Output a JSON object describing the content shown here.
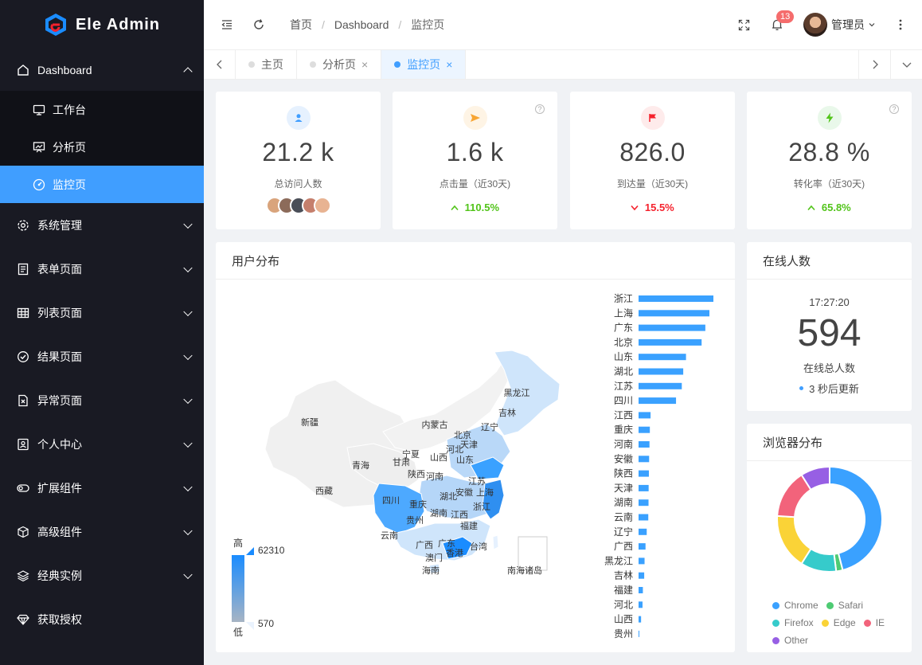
{
  "app": {
    "title": "Ele Admin"
  },
  "sidebar": {
    "dashboard": {
      "label": "Dashboard",
      "children": [
        "工作台",
        "分析页",
        "监控页"
      ]
    },
    "items": [
      "系统管理",
      "表单页面",
      "列表页面",
      "结果页面",
      "异常页面",
      "个人中心",
      "扩展组件",
      "高级组件",
      "经典实例",
      "获取授权"
    ]
  },
  "header": {
    "breadcrumb": [
      "首页",
      "Dashboard",
      "监控页"
    ],
    "notify_count": "13",
    "user_name": "管理员"
  },
  "tabs": [
    {
      "label": "主页",
      "closable": false
    },
    {
      "label": "分析页",
      "closable": true
    },
    {
      "label": "监控页",
      "closable": true,
      "active": true
    }
  ],
  "stats": [
    {
      "value": "21.2 k",
      "label": "总访问人数"
    },
    {
      "value": "1.6 k",
      "label": "点击量（近30天)",
      "trend": "110.5%",
      "dir": "up"
    },
    {
      "value": "826.0",
      "label": "到达量（近30天)",
      "trend": "15.5%",
      "dir": "down"
    },
    {
      "value": "28.8 %",
      "label": "转化率（近30天)",
      "trend": "65.8%",
      "dir": "up"
    }
  ],
  "user_dist": {
    "title": "用户分布",
    "scale_high": "高",
    "scale_low": "低",
    "scale_max": "62310",
    "scale_min": "570",
    "map_labels": [
      "黑龙江",
      "吉林",
      "辽宁",
      "内蒙古",
      "北京",
      "天津",
      "河北",
      "新疆",
      "宁夏",
      "山西",
      "山东",
      "甘肃",
      "青海",
      "陕西",
      "河南",
      "江苏",
      "安徽",
      "上海",
      "四川",
      "重庆",
      "湖北",
      "浙江",
      "西藏",
      "湖南",
      "江西",
      "贵州",
      "福建",
      "云南",
      "广西",
      "广东",
      "台湾",
      "香港",
      "澳门",
      "海南",
      "南海诸岛"
    ]
  },
  "chart_data": {
    "type": "bar",
    "orientation": "horizontal",
    "categories": [
      "浙江",
      "上海",
      "广东",
      "北京",
      "山东",
      "湖北",
      "江苏",
      "四川",
      "江西",
      "重庆",
      "河南",
      "安徽",
      "陕西",
      "天津",
      "湖南",
      "云南",
      "辽宁",
      "广西",
      "黑龙江",
      "吉林",
      "福建",
      "河北",
      "山西",
      "贵州"
    ],
    "values": [
      62310,
      59000,
      55600,
      52500,
      39500,
      37200,
      36000,
      31200,
      10000,
      9400,
      9100,
      8800,
      8600,
      8400,
      8300,
      8100,
      6800,
      5800,
      5000,
      4700,
      3600,
      3300,
      2100,
      570
    ],
    "xlim": [
      0,
      62310
    ]
  },
  "online": {
    "title": "在线人数",
    "time": "17:27:20",
    "count": "594",
    "label": "在线总人数",
    "update": "3 秒后更新"
  },
  "browser": {
    "title": "浏览器分布",
    "chart": {
      "type": "pie",
      "series": [
        {
          "name": "Chrome",
          "value": 46,
          "color": "#3aa1ff"
        },
        {
          "name": "Safari",
          "value": 2,
          "color": "#4ecb73"
        },
        {
          "name": "Firefox",
          "value": 11,
          "color": "#36cbcb"
        },
        {
          "name": "Edge",
          "value": 17,
          "color": "#fad337"
        },
        {
          "name": "IE",
          "value": 15,
          "color": "#f2637b"
        },
        {
          "name": "Other",
          "value": 9,
          "color": "#975fe4"
        }
      ]
    }
  }
}
